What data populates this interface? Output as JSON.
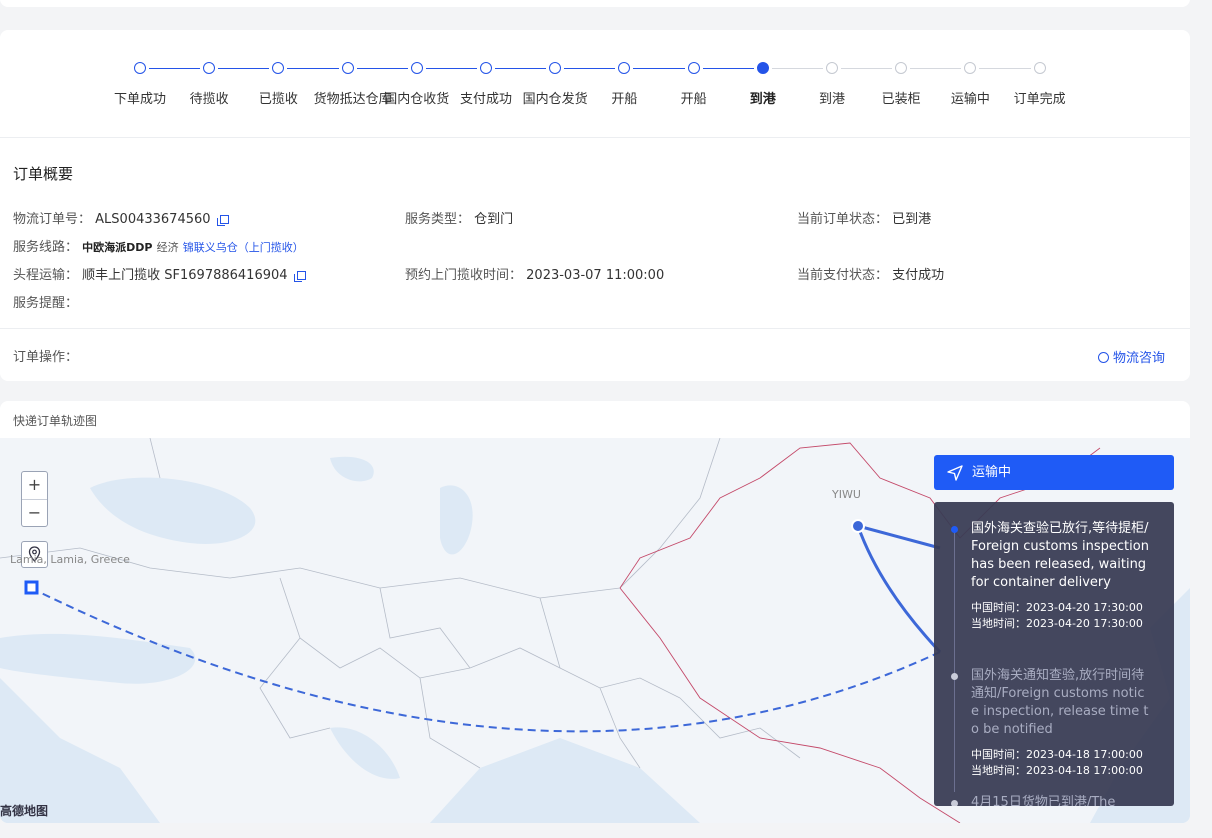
{
  "steps": [
    {
      "label": "下单成功",
      "state": "done"
    },
    {
      "label": "待揽收",
      "state": "done"
    },
    {
      "label": "已揽收",
      "state": "done"
    },
    {
      "label": "货物抵达仓库",
      "state": "done"
    },
    {
      "label": "国内仓收货",
      "state": "done"
    },
    {
      "label": "支付成功",
      "state": "done"
    },
    {
      "label": "国内仓发货",
      "state": "done"
    },
    {
      "label": "开船",
      "state": "done"
    },
    {
      "label": "开船",
      "state": "done"
    },
    {
      "label": "到港",
      "state": "current"
    },
    {
      "label": "到港",
      "state": "todo"
    },
    {
      "label": "已装柜",
      "state": "todo"
    },
    {
      "label": "运输中",
      "state": "todo"
    },
    {
      "label": "订单完成",
      "state": "todo"
    }
  ],
  "summary": {
    "title": "订单概要",
    "order_no_label": "物流订单号：",
    "order_no": "ALS00433674560",
    "service_type_label": "服务类型：",
    "service_type": "仓到门",
    "order_status_label": "当前订单状态：",
    "order_status": "已到港",
    "route_label": "服务线路：",
    "route_name": "中欧海派DDP",
    "route_tier": "经济",
    "route_warehouse": "锦联义乌仓（上门揽收）",
    "first_leg_label": "头程运输：",
    "first_leg": "顺丰上门揽收 SF1697886416904",
    "pickup_time_label": "预约上门揽收时间：",
    "pickup_time": "2023-03-07 11:00:00",
    "pay_status_label": "当前支付状态：",
    "pay_status": "支付成功",
    "reminder_label": "服务提醒：",
    "operation_label": "订单操作：",
    "consult_label": "物流咨询"
  },
  "map": {
    "title": "快递订单轨迹图",
    "label_greece": "Lamia, Lamia, Greece",
    "label_yiwu": "YIWU",
    "zoom_in": "+",
    "zoom_out": "−",
    "logo": "高德地图"
  },
  "tracking": {
    "header": "运输中",
    "events": [
      {
        "title": "国外海关查验已放行,等待提柜/Foreign customs inspection has been released, waiting for container delivery",
        "cn_time": "中国时间：2023-04-20 17:30:00",
        "local_time": "当地时间：2023-04-20 17:30:00",
        "state": "active"
      },
      {
        "title": "国外海关通知查验,放行时间待通知/Foreign customs notice inspection, release time to be notified",
        "cn_time": "中国时间：2023-04-18 17:00:00",
        "local_time": "当地时间：2023-04-18 17:00:00",
        "state": "inactive"
      },
      {
        "title": "4月15日货物已到港/The",
        "cn_time": "",
        "local_time": "",
        "state": "inactive"
      }
    ]
  },
  "colors": {
    "accent": "#2454e8",
    "panel": "#383c54",
    "header": "#1f5bf6"
  }
}
